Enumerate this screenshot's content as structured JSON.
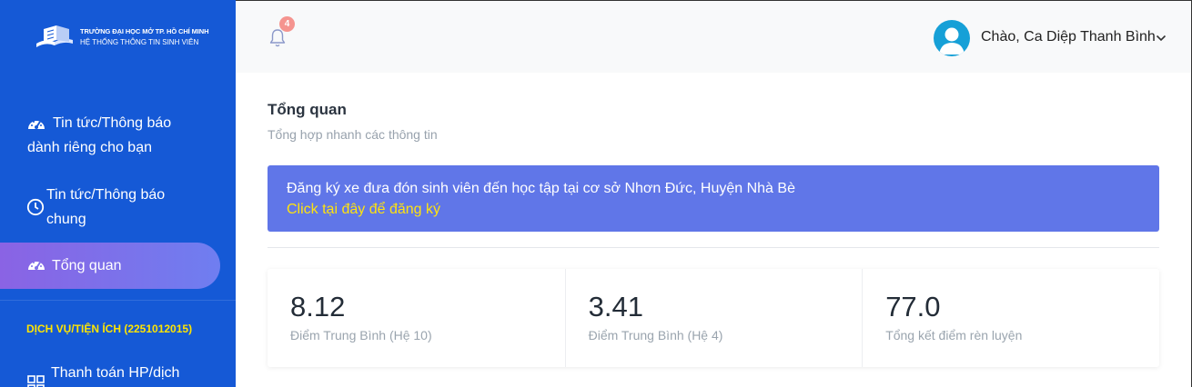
{
  "logo": {
    "line1": "TRƯỜNG ĐẠI HỌC MỞ TP. HỒ CHÍ MINH",
    "line2": "HỆ THỐNG THÔNG TIN SINH VIÊN"
  },
  "sidebar": {
    "items": [
      {
        "line1": "Tin tức/Thông báo",
        "line2": "dành riêng cho bạn",
        "icon": "dashboard-icon"
      },
      {
        "line1": "Tin tức/Thông báo",
        "line2": "chung",
        "icon": "clock-icon"
      },
      {
        "line1": "Tổng quan",
        "icon": "dashboard-icon",
        "active": true
      }
    ],
    "section_title": "DỊCH VỤ/TIỆN ÍCH (2251012015)",
    "service_items": [
      {
        "line1": "Thanh toán HP/dịch",
        "icon": "grid-icon"
      }
    ]
  },
  "header": {
    "notification_count": "4",
    "greeting": "Chào, Ca Diệp Thanh Bình"
  },
  "main": {
    "title": "Tổng quan",
    "subtitle": "Tổng hợp nhanh các thông tin",
    "alert": {
      "text": "Đăng ký xe đưa đón sinh viên đến học tập tại cơ sở Nhơn Đức, Huyện Nhà Bè",
      "link": "Click tại đây để đăng ký"
    },
    "stats": [
      {
        "value": "8.12",
        "label": "Điểm Trung Bình (Hệ 10)"
      },
      {
        "value": "3.41",
        "label": "Điểm Trung Bình (Hệ 4)"
      },
      {
        "value": "77.0",
        "label": "Tổng kết điểm rèn luyện"
      }
    ]
  },
  "colors": {
    "sidebar": "#1559d6",
    "active_item": "#7c70ea",
    "section_title": "#ffe500",
    "alert_bg": "#6076e8",
    "alert_link": "#ffe30e",
    "badge": "#f5948f",
    "avatar": "#16a0d7"
  }
}
